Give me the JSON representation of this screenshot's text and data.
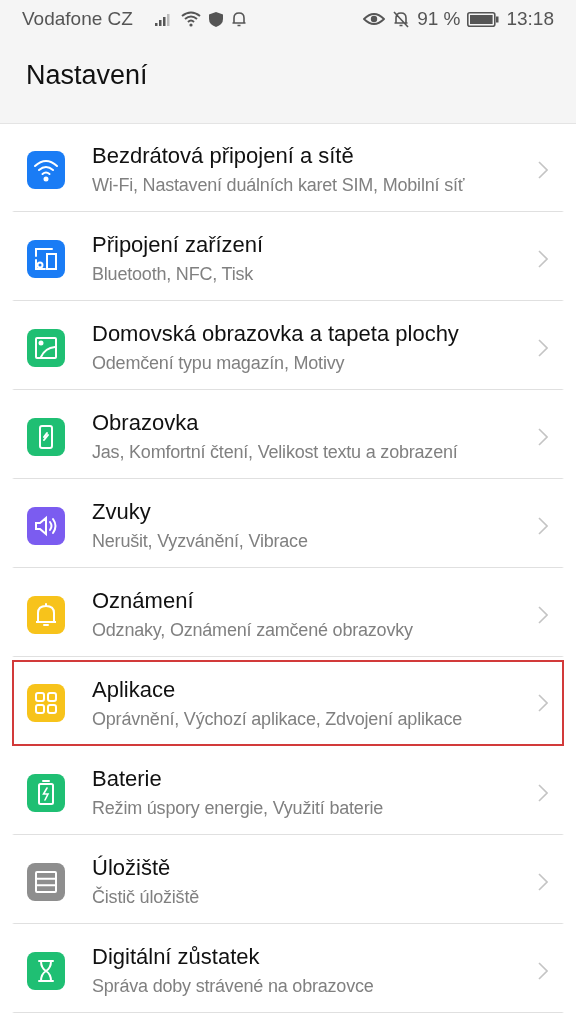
{
  "status_bar": {
    "carrier": "Vodafone CZ",
    "battery": "91 %",
    "time": "13:18"
  },
  "header": {
    "title": "Nastavení"
  },
  "items": [
    {
      "kind": "wifi",
      "color": "#1a7cf5",
      "title": "Bezdrátová připojení a sítě",
      "subtitle": "Wi-Fi, Nastavení duálních karet SIM, Mobilní síť",
      "highlighted": false
    },
    {
      "kind": "devices",
      "color": "#1a7cf5",
      "title": "Připojení zařízení",
      "subtitle": "Bluetooth, NFC, Tisk",
      "highlighted": false
    },
    {
      "kind": "wallpaper",
      "color": "#1fbf73",
      "title": "Domovská obrazovka a tapeta plochy",
      "subtitle": "Odemčení typu magazín, Motivy",
      "highlighted": false
    },
    {
      "kind": "display",
      "color": "#1fbf73",
      "title": "Obrazovka",
      "subtitle": "Jas, Komfortní čtení, Velikost textu a zobrazení",
      "highlighted": false
    },
    {
      "kind": "sound",
      "color": "#7b5cf0",
      "title": "Zvuky",
      "subtitle": "Nerušit, Vyzvánění, Vibrace",
      "highlighted": false
    },
    {
      "kind": "bell",
      "color": "#f7c31b",
      "title": "Oznámení",
      "subtitle": "Odznaky, Oznámení zamčené obrazovky",
      "highlighted": false
    },
    {
      "kind": "apps",
      "color": "#f7c31b",
      "title": "Aplikace",
      "subtitle": "Oprávnění, Výchozí aplikace, Zdvojení aplikace",
      "highlighted": true
    },
    {
      "kind": "battery",
      "color": "#1fbf73",
      "title": "Baterie",
      "subtitle": "Režim úspory energie, Využití baterie",
      "highlighted": false
    },
    {
      "kind": "storage",
      "color": "#8e8e8e",
      "title": "Úložiště",
      "subtitle": "Čistič úložiště",
      "highlighted": false
    },
    {
      "kind": "hourglass",
      "color": "#1fbf73",
      "title": "Digitální zůstatek",
      "subtitle": "Správa doby strávené na obrazovce",
      "highlighted": false
    }
  ]
}
